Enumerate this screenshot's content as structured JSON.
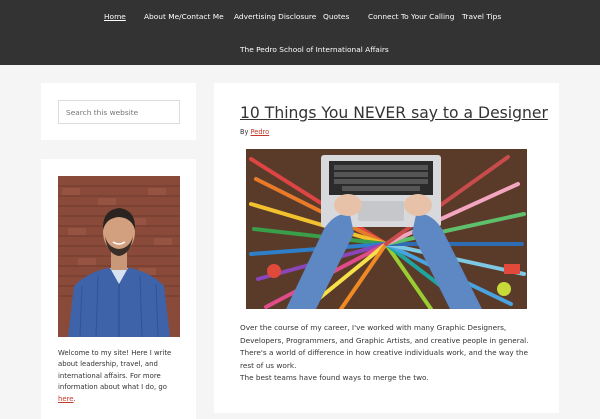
{
  "nav": {
    "items": [
      {
        "label": "Home",
        "active": true
      },
      {
        "label": "About Me/Contact Me"
      },
      {
        "label": "Advertising Disclosure"
      },
      {
        "label": "Quotes"
      },
      {
        "label": "Connect To Your Calling"
      },
      {
        "label": "Travel Tips"
      },
      {
        "label": "The Pedro School of International Affairs"
      }
    ]
  },
  "sidebar": {
    "search_placeholder": "Search this website",
    "about": {
      "text": "Welcome to my site! Here I write about leadership, travel, and international affairs. For more information about what I do, go ",
      "link": "here",
      "end": "."
    }
  },
  "post": {
    "title": "10 Things You NEVER say to a Designer",
    "by_prefix": "By ",
    "author": "Pedro",
    "paragraphs": [
      "Over the course of my career, I've worked with many Graphic Designers, Developers, Programmers, and Graphic Artists, and creative people in general. There's a world of difference in how creative individuals work, and the way the rest of us work.",
      "The best teams have found ways to merge the two."
    ]
  },
  "colors": {
    "header_bg": "#333333",
    "page_bg": "#f5f5f5",
    "link": "#c0392b"
  },
  "icons": []
}
